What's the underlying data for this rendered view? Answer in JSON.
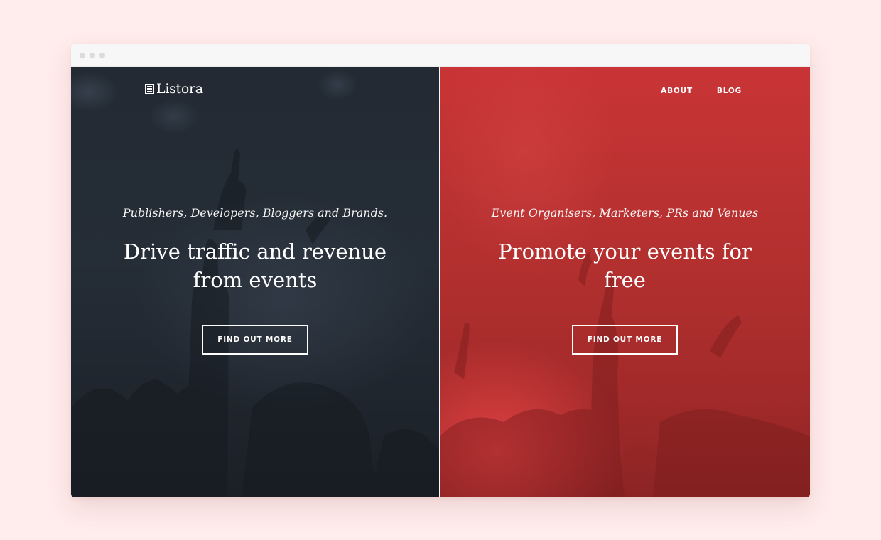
{
  "brand": {
    "name": "Listora",
    "logo_icon": "listora-logo-icon"
  },
  "nav": {
    "items": [
      {
        "label": "ABOUT"
      },
      {
        "label": "BLOG"
      }
    ]
  },
  "left_panel": {
    "kicker": "Publishers, Developers, Bloggers and Brands.",
    "headline": "Drive traffic and revenue from events",
    "cta_label": "FIND OUT MORE",
    "background_color": "#232a33"
  },
  "right_panel": {
    "kicker": "Event Organisers, Marketers, PRs and Venues",
    "headline": "Promote your events for free",
    "cta_label": "FIND OUT MORE",
    "background_color": "#c93436"
  },
  "colors": {
    "page_background": "#ffecec",
    "accent_red": "#c93436",
    "dark_navy": "#232a33"
  }
}
